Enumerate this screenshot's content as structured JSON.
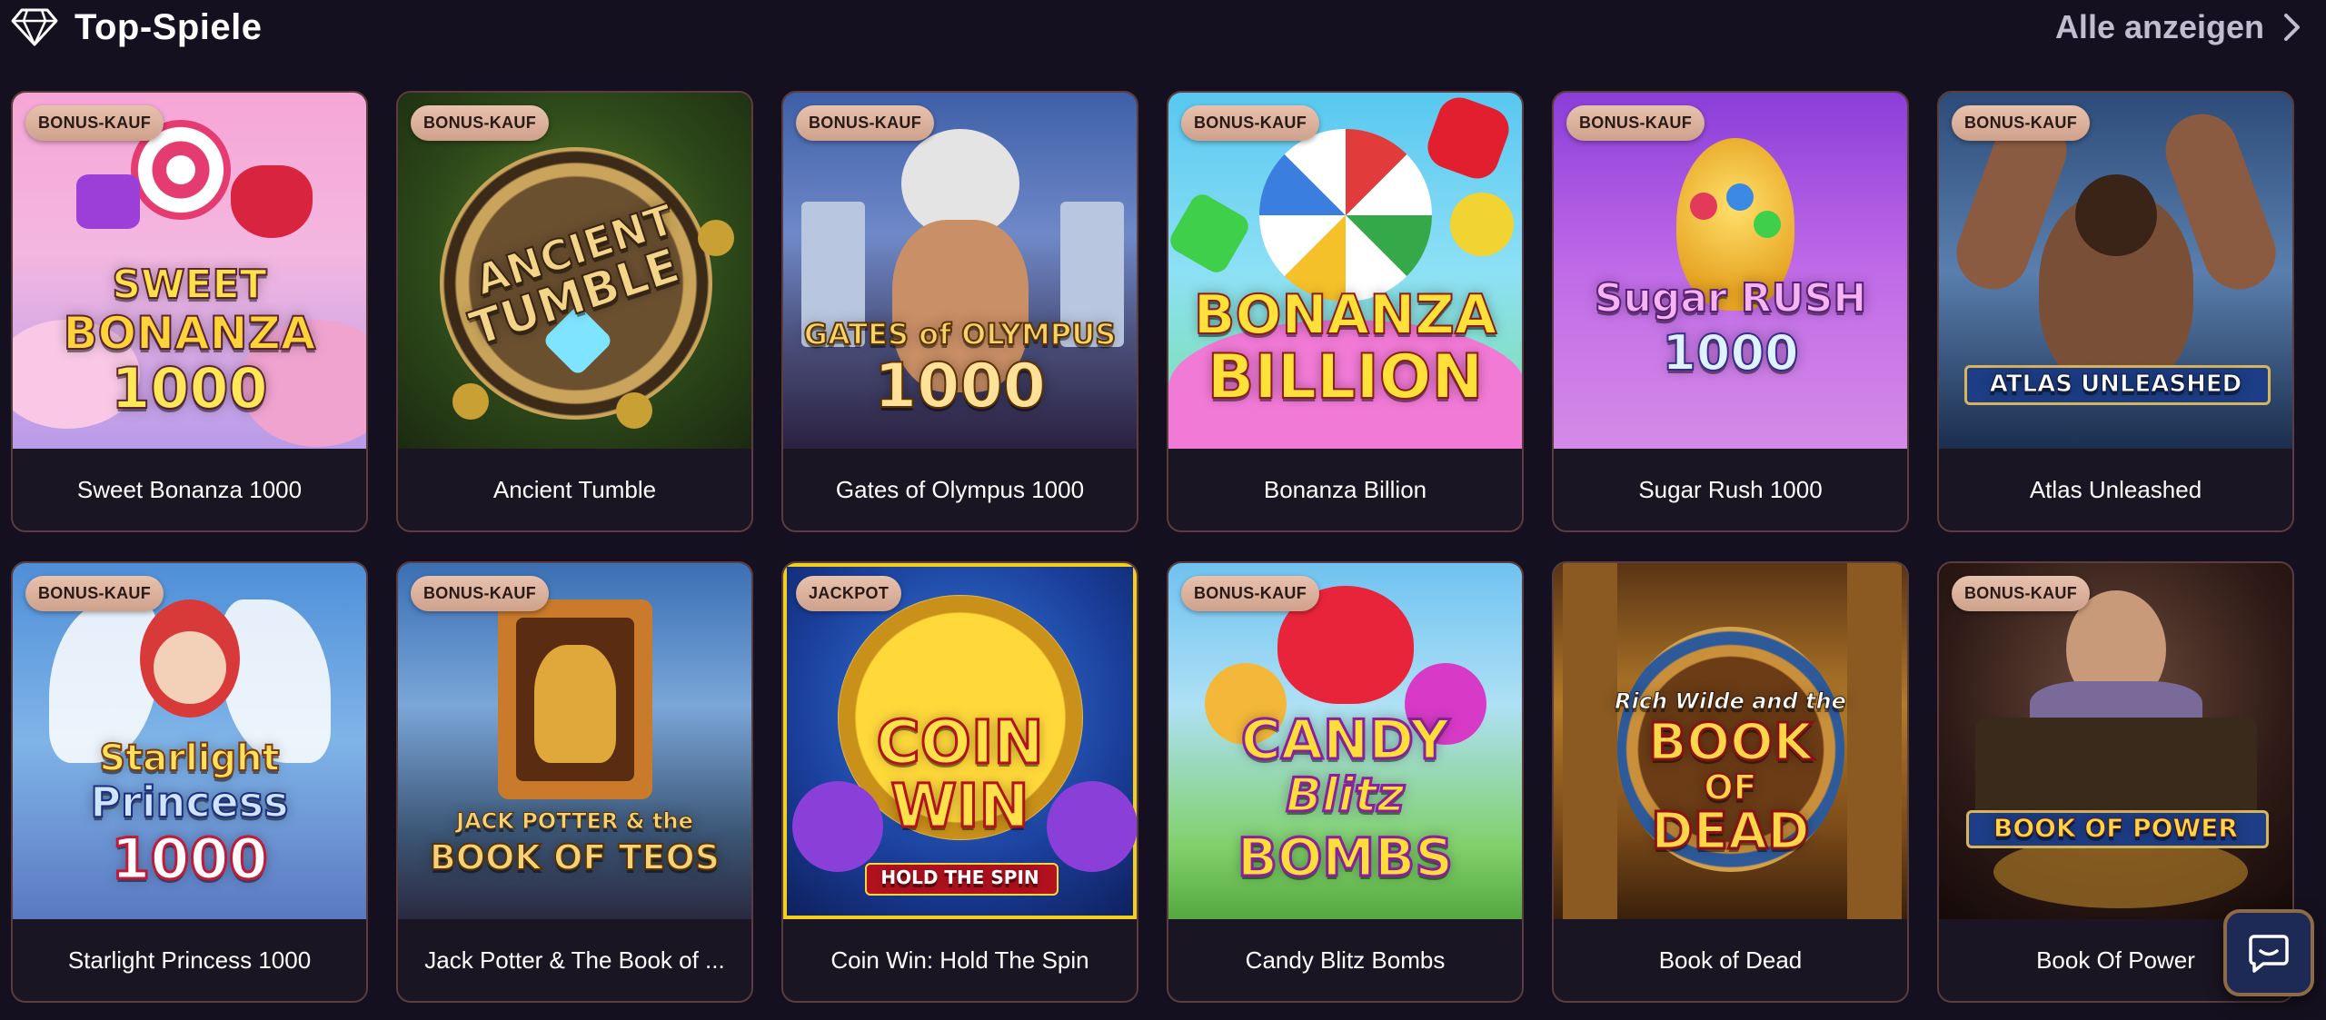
{
  "header": {
    "title": "Top-Spiele",
    "view_all_label": "Alle anzeigen"
  },
  "games": [
    {
      "name": "Sweet Bonanza 1000",
      "badge": "BONUS-KAUF",
      "art_lines": [
        "SWEET",
        "BONANZA",
        "1000"
      ]
    },
    {
      "name": "Ancient Tumble",
      "badge": "BONUS-KAUF",
      "art_lines": [
        "ANCIENT",
        "TUMBLE"
      ]
    },
    {
      "name": "Gates of Olympus 1000",
      "badge": "BONUS-KAUF",
      "art_lines": [
        "GATES of OLYMPUS",
        "1000"
      ]
    },
    {
      "name": "Bonanza Billion",
      "badge": "BONUS-KAUF",
      "art_lines": [
        "BONANZA",
        "BILLION"
      ]
    },
    {
      "name": "Sugar Rush 1000",
      "badge": "BONUS-KAUF",
      "art_lines": [
        "Sugar RUSH",
        "1000"
      ]
    },
    {
      "name": "Atlas Unleashed",
      "badge": "BONUS-KAUF",
      "art_lines": [
        "ATLAS UNLEASHED"
      ]
    },
    {
      "name": "Starlight Princess 1000",
      "badge": "BONUS-KAUF",
      "art_lines": [
        "Starlight",
        "Princess",
        "1000"
      ]
    },
    {
      "name": "Jack Potter & The Book of ...",
      "badge": "BONUS-KAUF",
      "art_lines": [
        "JACK POTTER & the",
        "BOOK OF TEOS"
      ]
    },
    {
      "name": "Coin Win: Hold The Spin",
      "badge": "JACKPOT",
      "art_lines": [
        "COIN",
        "WIN",
        "HOLD THE SPIN"
      ]
    },
    {
      "name": "Candy Blitz Bombs",
      "badge": "BONUS-KAUF",
      "art_lines": [
        "CANDY",
        "Blitz",
        "BOMBS"
      ]
    },
    {
      "name": "Book of Dead",
      "badge": "",
      "art_lines": [
        "Rich Wilde and the",
        "BOOK",
        "OF",
        "DEAD"
      ]
    },
    {
      "name": "Book Of Power",
      "badge": "BONUS-KAUF",
      "art_lines": [
        "BOOK OF POWER"
      ]
    }
  ],
  "icons": {
    "header": "diamond-icon",
    "view_all": "chevron-right-icon",
    "chat": "chat-icon"
  },
  "colors": {
    "background": "#15101f",
    "badge": "#dcb19c",
    "jackpot_border": "#f2cf1d",
    "card_border": "#5b3d3f"
  }
}
